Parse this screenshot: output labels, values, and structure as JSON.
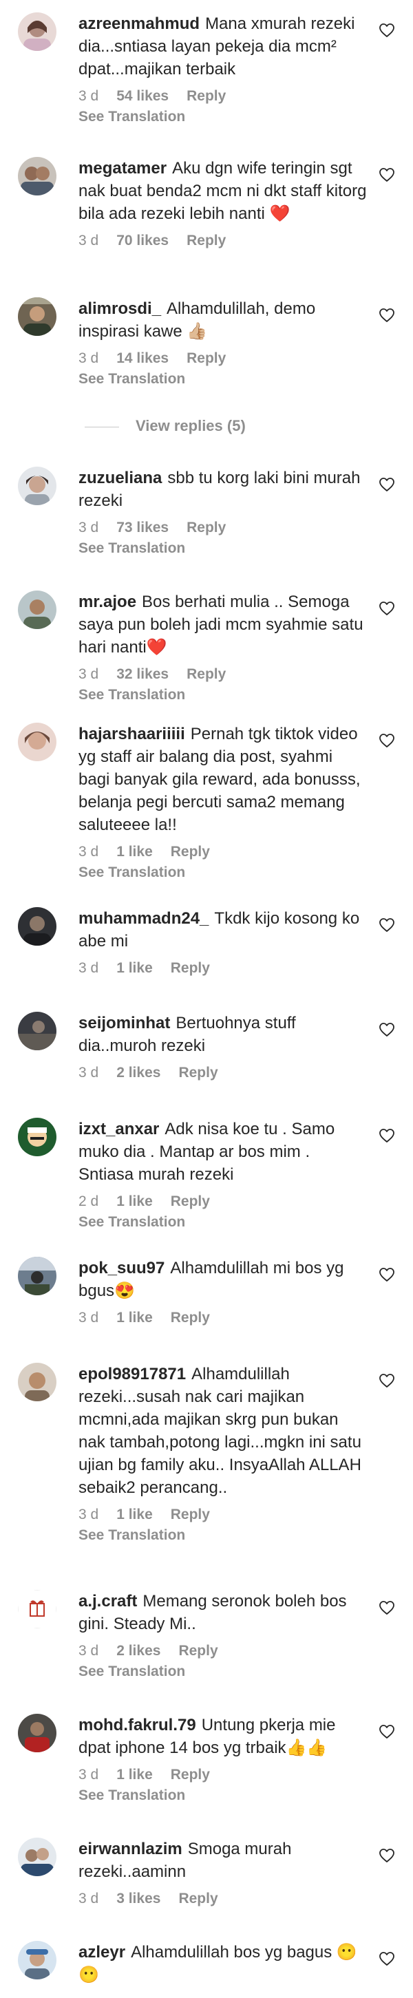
{
  "view_replies_label": "View replies (5)",
  "colors": {
    "text": "#262626",
    "muted": "#8e8e8e"
  },
  "comments": [
    {
      "username": "azreenmahmud",
      "text": "Mana xmurah rezeki dia...sntiasa layan pekeja dia mcm² dpat...majikan terbaik",
      "time": "3 d",
      "likes": "54 likes",
      "reply": "Reply",
      "translation": "See Translation"
    },
    {
      "username": "megatamer",
      "text": "Aku dgn wife teringin sgt nak buat benda2 mcm ni dkt staff kitorg bila ada rezeki lebih nanti ❤️",
      "time": "3 d",
      "likes": "70 likes",
      "reply": "Reply",
      "translation": ""
    },
    {
      "username": "alimrosdi_",
      "text": "Alhamdulillah, demo inspirasi kawe 👍🏼",
      "time": "3 d",
      "likes": "14 likes",
      "reply": "Reply",
      "translation": "See Translation"
    },
    {
      "username": "zuzueliana",
      "text": "sbb tu korg laki bini murah rezeki",
      "time": "3 d",
      "likes": "73 likes",
      "reply": "Reply",
      "translation": "See Translation"
    },
    {
      "username": "mr.ajoe",
      "text": "Bos berhati mulia .. Semoga saya pun boleh jadi mcm syahmie satu hari nanti❤️",
      "time": "3 d",
      "likes": "32 likes",
      "reply": "Reply",
      "translation": "See Translation"
    },
    {
      "username": "hajarshaariiiii",
      "text": "Pernah tgk tiktok video yg staff air balang dia post, syahmi bagi banyak gila reward, ada bonusss, belanja pegi bercuti sama2 memang saluteeee la!!",
      "time": "3 d",
      "likes": "1 like",
      "reply": "Reply",
      "translation": "See Translation"
    },
    {
      "username": "muhammadn24_",
      "text": "Tkdk kijo kosong ko abe mi",
      "time": "3 d",
      "likes": "1 like",
      "reply": "Reply",
      "translation": ""
    },
    {
      "username": "seijominhat",
      "text": "Bertuohnya stuff dia..muroh rezeki",
      "time": "3 d",
      "likes": "2 likes",
      "reply": "Reply",
      "translation": ""
    },
    {
      "username": "izxt_anxar",
      "text": "Adk nisa koe tu . Samo muko dia . Mantap ar bos mim . Sntiasa murah rezeki",
      "time": "2 d",
      "likes": "1 like",
      "reply": "Reply",
      "translation": "See Translation"
    },
    {
      "username": "pok_suu97",
      "text": "Alhamdulillah mi bos yg bgus😍",
      "time": "3 d",
      "likes": "1 like",
      "reply": "Reply",
      "translation": ""
    },
    {
      "username": "epol98917871",
      "text": "Alhamdulillah rezeki...susah nak cari majikan mcmni,ada majikan skrg pun bukan nak tambah,potong lagi...mgkn ini satu ujian bg family aku.. InsyaAllah ALLAH sebaik2 perancang..",
      "time": "3 d",
      "likes": "1 like",
      "reply": "Reply",
      "translation": "See Translation"
    },
    {
      "username": "a.j.craft",
      "text": "Memang seronok boleh bos gini. Steady Mi..",
      "time": "3 d",
      "likes": "2 likes",
      "reply": "Reply",
      "translation": "See Translation"
    },
    {
      "username": "mohd.fakrul.79",
      "text": "Untung pkerja mie dpat iphone 14 bos yg trbaik👍👍",
      "time": "3 d",
      "likes": "1 like",
      "reply": "Reply",
      "translation": "See Translation"
    },
    {
      "username": "eirwannlazim",
      "text": "Smoga murah rezeki..aaminn",
      "time": "3 d",
      "likes": "3 likes",
      "reply": "Reply",
      "translation": ""
    },
    {
      "username": "azleyr",
      "text": "Alhamdulillah bos yg bagus 😶😶",
      "time": "",
      "likes": "",
      "reply": "",
      "translation": ""
    }
  ]
}
